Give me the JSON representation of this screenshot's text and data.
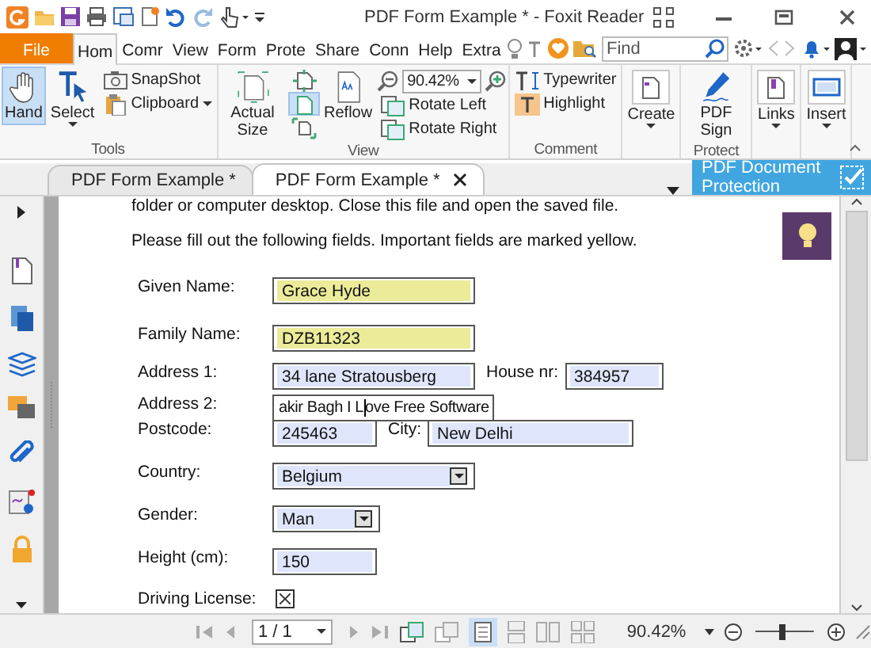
{
  "window": {
    "title": "PDF Form Example * - Foxit Reader"
  },
  "menu_tabs": [
    {
      "label": "File",
      "kind": "file",
      "selected": false
    },
    {
      "label": "Hom",
      "kind": "tab",
      "selected": true
    },
    {
      "label": "Comr",
      "kind": "tab",
      "selected": false
    },
    {
      "label": "View",
      "kind": "tab",
      "selected": false
    },
    {
      "label": "Form",
      "kind": "tab",
      "selected": false
    },
    {
      "label": "Prote",
      "kind": "tab",
      "selected": false
    },
    {
      "label": "Share",
      "kind": "tab",
      "selected": false
    },
    {
      "label": "Conn",
      "kind": "tab",
      "selected": false
    },
    {
      "label": "Help",
      "kind": "tab",
      "selected": false
    },
    {
      "label": "Extra",
      "kind": "tab",
      "selected": false
    }
  ],
  "find": {
    "placeholder": "Find"
  },
  "ribbon": {
    "groups": [
      {
        "label": "Tools",
        "items": [
          {
            "kind": "large",
            "label": "Hand",
            "selected": true
          },
          {
            "kind": "large",
            "label": "Select",
            "dropdown": true
          },
          {
            "kind": "stack",
            "items": [
              {
                "kind": "small",
                "label": "SnapShot"
              },
              {
                "kind": "small",
                "label": "Clipboard",
                "dropdown": true
              }
            ]
          }
        ]
      },
      {
        "label": "View",
        "items": [
          {
            "kind": "large",
            "label": "Actual Size"
          },
          {
            "kind": "stack",
            "items": [
              {
                "kind": "icon",
                "selected": false
              },
              {
                "kind": "icon",
                "selected": true
              },
              {
                "kind": "icon",
                "selected": false
              }
            ]
          },
          {
            "kind": "large",
            "label": "Reflow"
          },
          {
            "kind": "stack",
            "items": [
              {
                "kind": "zoom",
                "value": "90.42%"
              },
              {
                "kind": "small",
                "label": "Rotate Left"
              },
              {
                "kind": "small",
                "label": "Rotate Right"
              }
            ]
          }
        ]
      },
      {
        "label": "Comment",
        "items": [
          {
            "kind": "stack",
            "items": [
              {
                "kind": "small",
                "label": "Typewriter"
              },
              {
                "kind": "small",
                "label": "Highlight"
              }
            ]
          }
        ]
      },
      {
        "items": [
          {
            "kind": "boxed",
            "label": "Create",
            "dropdown": true
          }
        ]
      },
      {
        "label": "Protect",
        "items": [
          {
            "kind": "large",
            "label": "PDF Sign"
          }
        ]
      },
      {
        "items": [
          {
            "kind": "boxed",
            "label": "Links",
            "dropdown": true
          }
        ]
      },
      {
        "items": [
          {
            "kind": "boxed",
            "label": "Insert",
            "dropdown": true
          }
        ]
      }
    ]
  },
  "doc_tabs": [
    {
      "label": "PDF Form Example *",
      "selected": false
    },
    {
      "label": "PDF Form Example *",
      "selected": true
    }
  ],
  "protection_panel": {
    "label": "PDF Document Protection"
  },
  "document": {
    "paragraphs": [
      "folder or computer desktop. Close this file and open the saved file.",
      "Please fill out the following fields. Important fields are marked yellow."
    ],
    "rows": [
      {
        "fields": [
          {
            "label": "Given Name:",
            "kind": "text",
            "value": "Grace Hyde",
            "required": true
          }
        ]
      },
      {
        "fields": [
          {
            "label": "Family Name:",
            "kind": "text",
            "value": "DZB11323",
            "required": true
          }
        ]
      },
      {
        "fields": [
          {
            "label": "Address 1:",
            "kind": "text",
            "value": "34 lane Stratousberg",
            "required": false
          },
          {
            "label": "House nr:",
            "kind": "text",
            "value": "384957",
            "required": false
          }
        ]
      },
      {
        "fields": [
          {
            "label": "Address 2:",
            "kind": "text",
            "value": "akir Bagh I Love Free Software",
            "required": false,
            "focused": true
          }
        ]
      },
      {
        "fields": [
          {
            "label": "Postcode:",
            "kind": "text",
            "value": "245463",
            "required": false
          },
          {
            "label": "City:",
            "kind": "text",
            "value": "New Delhi",
            "required": false
          }
        ]
      },
      {
        "fields": [
          {
            "label": "Country:",
            "kind": "dropdown",
            "value": "Belgium",
            "required": false
          }
        ]
      },
      {
        "fields": [
          {
            "label": "Gender:",
            "kind": "dropdown",
            "value": "Man",
            "required": false
          }
        ]
      },
      {
        "fields": [
          {
            "label": "Height (cm):",
            "kind": "text",
            "value": "150",
            "required": false
          }
        ]
      },
      {
        "fields": [
          {
            "label": "Driving License:",
            "kind": "checkbox",
            "checked": true
          }
        ]
      }
    ]
  },
  "status_bar": {
    "page": "1 / 1",
    "zoom": "90.42%",
    "zoom_slider": {
      "level": 0.45
    }
  }
}
